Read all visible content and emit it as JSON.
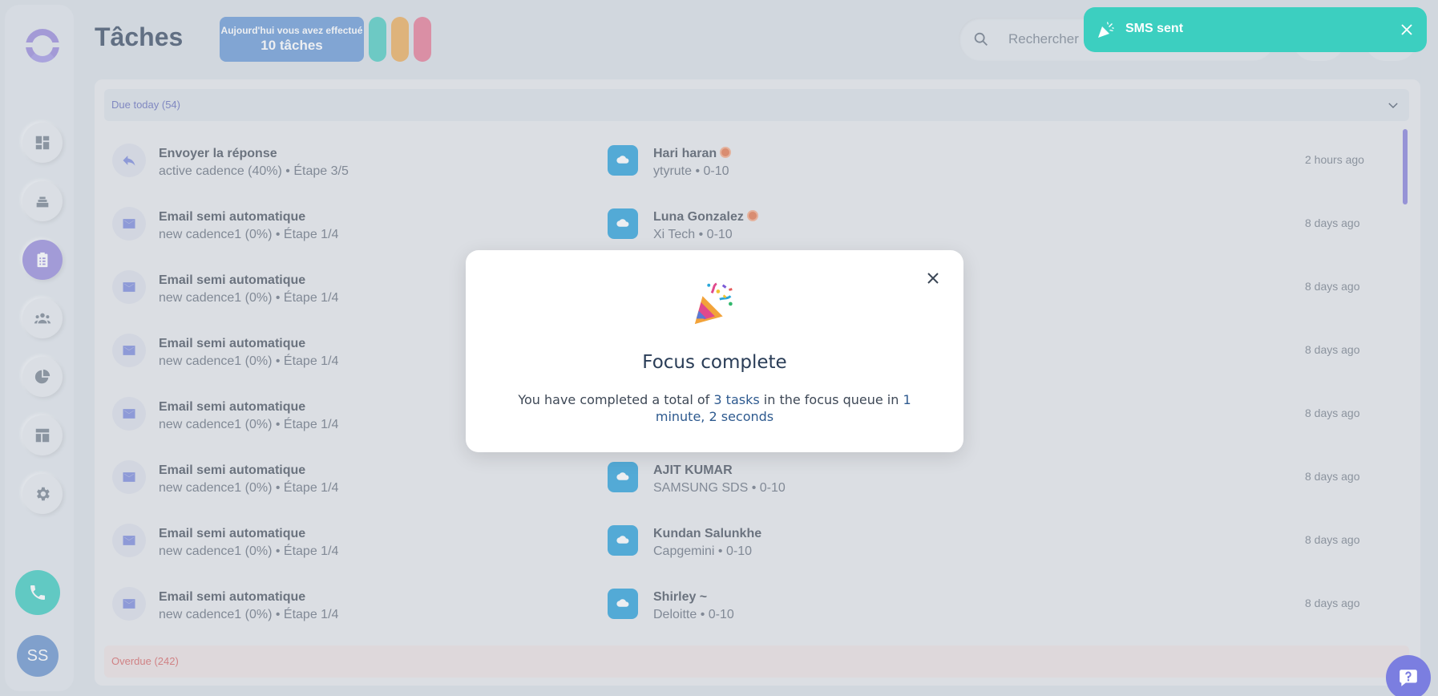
{
  "header": {
    "title": "Tâches",
    "stat_line1": "Aujourd'hui vous avez effectué",
    "stat_line2": "10 tâches",
    "search_placeholder": "Rechercher"
  },
  "pills": [
    "#3cc7bb",
    "#eaa54b",
    "#e46d8b"
  ],
  "avatar_initials": "SS",
  "group_due": "Due today (54)",
  "group_overdue": "Overdue (242)",
  "tasks": [
    {
      "icon": "reply-icon",
      "title": "Envoyer la réponse",
      "sub": "active cadence (40%) • Étape 3/5",
      "contact": "Hari haran",
      "flag": true,
      "company": "ytyrute • 0-10",
      "time": "2 hours ago"
    },
    {
      "icon": "email-icon",
      "title": "Email semi automatique",
      "sub": "new cadence1 (0%) • Étape 1/4",
      "contact": "Luna Gonzalez",
      "flag": true,
      "company": "Xi Tech • 0-10",
      "time": "8 days ago"
    },
    {
      "icon": "email-icon",
      "title": "Email semi automatique",
      "sub": "new cadence1 (0%) • Étape 1/4",
      "contact": "",
      "flag": false,
      "company": "",
      "time": "8 days ago"
    },
    {
      "icon": "email-icon",
      "title": "Email semi automatique",
      "sub": "new cadence1 (0%) • Étape 1/4",
      "contact": "",
      "flag": false,
      "company": "",
      "time": "8 days ago"
    },
    {
      "icon": "email-icon",
      "title": "Email semi automatique",
      "sub": "new cadence1 (0%) • Étape 1/4",
      "contact": "",
      "flag": false,
      "company": "",
      "time": "8 days ago"
    },
    {
      "icon": "email-icon",
      "title": "Email semi automatique",
      "sub": "new cadence1 (0%) • Étape 1/4",
      "contact": "AJIT KUMAR",
      "flag": false,
      "company": "SAMSUNG SDS • 0-10",
      "time": "8 days ago"
    },
    {
      "icon": "email-icon",
      "title": "Email semi automatique",
      "sub": "new cadence1 (0%) • Étape 1/4",
      "contact": "Kundan Salunkhe",
      "flag": false,
      "company": "Capgemini • 0-10",
      "time": "8 days ago"
    },
    {
      "icon": "email-icon",
      "title": "Email semi automatique",
      "sub": "new cadence1 (0%) • Étape 1/4",
      "contact": "Shirley ~",
      "flag": false,
      "company": "Deloitte • 0-10",
      "time": "8 days ago"
    }
  ],
  "toast": {
    "message": "SMS sent"
  },
  "modal": {
    "title": "Focus complete",
    "text_before": "You have completed a total of ",
    "tasks_count": "3 tasks",
    "text_middle": " in the focus queue in ",
    "duration": "1 minute, 2 seconds"
  }
}
